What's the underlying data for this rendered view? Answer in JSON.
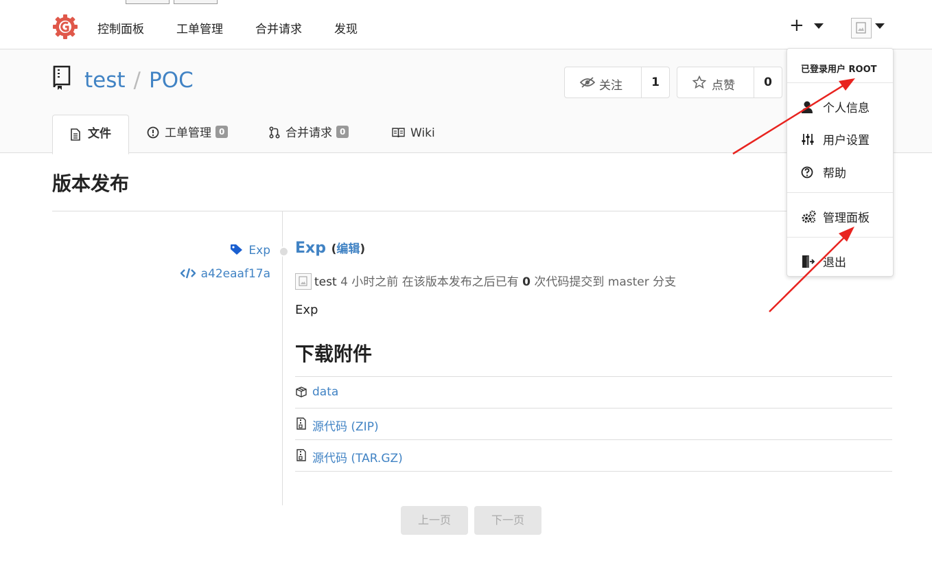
{
  "nav": {
    "items": [
      "控制面板",
      "工单管理",
      "合并请求",
      "发现"
    ],
    "plus_label": "+"
  },
  "repo": {
    "owner": "test",
    "separator": "/",
    "name": "POC",
    "watch_label": "关注",
    "watch_count": "1",
    "star_label": "点赞",
    "star_count": "0"
  },
  "tabs": {
    "files": "文件",
    "issues": "工单管理",
    "issues_count": "0",
    "pulls": "合并请求",
    "pulls_count": "0",
    "wiki": "Wiki"
  },
  "page": {
    "title": "版本发布"
  },
  "release": {
    "tag": "Exp",
    "commit": "a42eaaf17a",
    "title": "Exp",
    "open_paren": "(",
    "edit_label": "编辑",
    "close_paren": ")",
    "author": "test",
    "time_ago": "4 小时之前",
    "meta_prefix": "在该版本发布之后已有",
    "commits_count": "0",
    "meta_suffix": "次代码提交到 master 分支",
    "body": "Exp",
    "downloads_title": "下载附件",
    "downloads": [
      "data",
      "源代码 (ZIP)",
      "源代码 (TAR.GZ)"
    ]
  },
  "pagination": {
    "prev": "上一页",
    "next": "下一页"
  },
  "dropdown": {
    "header": "已登录用户 ROOT",
    "items": [
      "个人信息",
      "用户设置",
      "帮助",
      "管理面板",
      "退出"
    ]
  },
  "colors": {
    "link": "#4183c4",
    "arrow": "#e8231f",
    "logo": "#e0584a",
    "tag": "#1a5fd0"
  }
}
